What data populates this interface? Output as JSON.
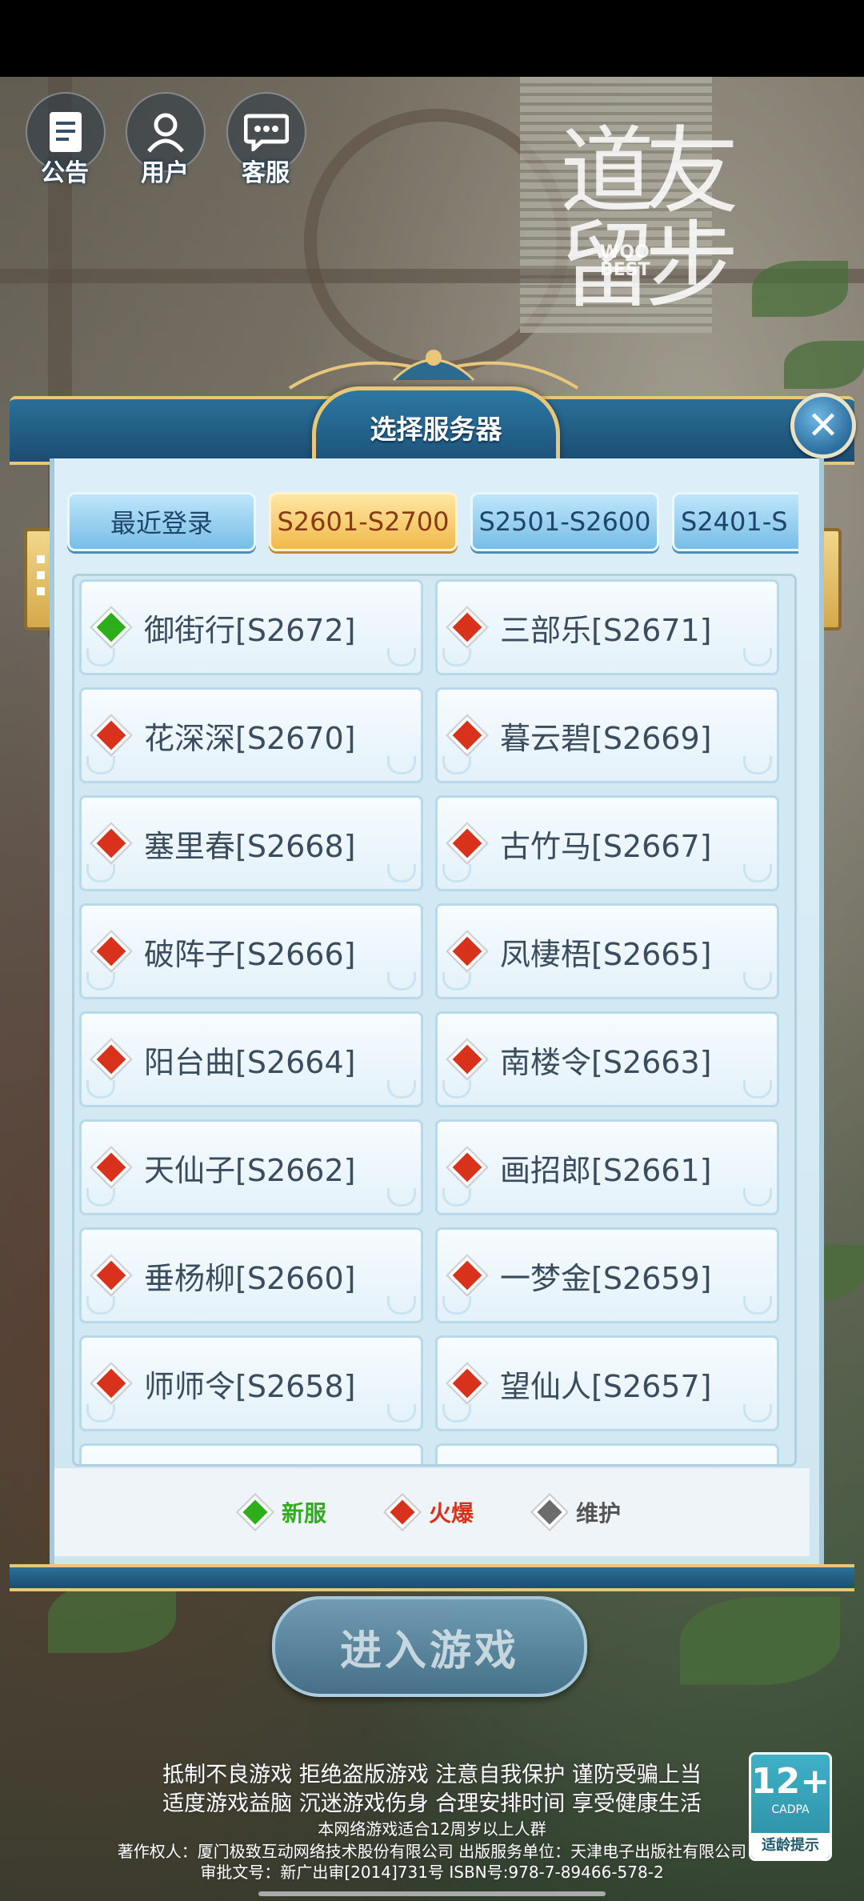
{
  "top_bar": {
    "notice_label": "公告",
    "user_label": "用户",
    "service_label": "客服"
  },
  "logo": {
    "title": "道友留步",
    "sub": "WOO BEST"
  },
  "dialog": {
    "title": "选择服务器",
    "close": "✕",
    "tabs": [
      {
        "label": "最近登录"
      },
      {
        "label": "S2601-S2700"
      },
      {
        "label": "S2501-S2600"
      },
      {
        "label": "S2401-S"
      }
    ],
    "servers": [
      {
        "name": "御街行[S2672]",
        "status": "new"
      },
      {
        "name": "三部乐[S2671]",
        "status": "hot"
      },
      {
        "name": "花深深[S2670]",
        "status": "hot"
      },
      {
        "name": "暮云碧[S2669]",
        "status": "hot"
      },
      {
        "name": "塞里春[S2668]",
        "status": "hot"
      },
      {
        "name": "古竹马[S2667]",
        "status": "hot"
      },
      {
        "name": "破阵子[S2666]",
        "status": "hot"
      },
      {
        "name": "凤棲梧[S2665]",
        "status": "hot"
      },
      {
        "name": "阳台曲[S2664]",
        "status": "hot"
      },
      {
        "name": "南楼令[S2663]",
        "status": "hot"
      },
      {
        "name": "天仙子[S2662]",
        "status": "hot"
      },
      {
        "name": "画招郎[S2661]",
        "status": "hot"
      },
      {
        "name": "垂杨柳[S2660]",
        "status": "hot"
      },
      {
        "name": "一梦金[S2659]",
        "status": "hot"
      },
      {
        "name": "师师令[S2658]",
        "status": "hot"
      },
      {
        "name": "望仙人[S2657]",
        "status": "hot"
      }
    ],
    "legend": [
      {
        "label": "新服",
        "color": "#2fae1c"
      },
      {
        "label": "火爆",
        "color": "#d8321c"
      },
      {
        "label": "维护",
        "color": "#6c6c6c"
      }
    ]
  },
  "enter_button": "进入游戏",
  "notices": {
    "line1": "抵制不良游戏 拒绝盗版游戏 注意自我保护 谨防受骗上当",
    "line2": "适度游戏益脑 沉迷游戏伤身 合理安排时间 享受健康生活",
    "line3": "本网络游戏适合12周岁以上人群",
    "line4": "著作权人：厦门极致互动网络技术股份有限公司 出版服务单位：天津电子出版社有限公司",
    "line5": "审批文号：新广出审[2014]731号  ISBN号:978-7-89466-578-2"
  },
  "age_badge": {
    "age": "12+",
    "org": "CADPA",
    "tip": "适龄提示"
  },
  "colors": {
    "new": "#2fae1c",
    "hot": "#d8321c",
    "maintenance": "#6c6c6c"
  }
}
